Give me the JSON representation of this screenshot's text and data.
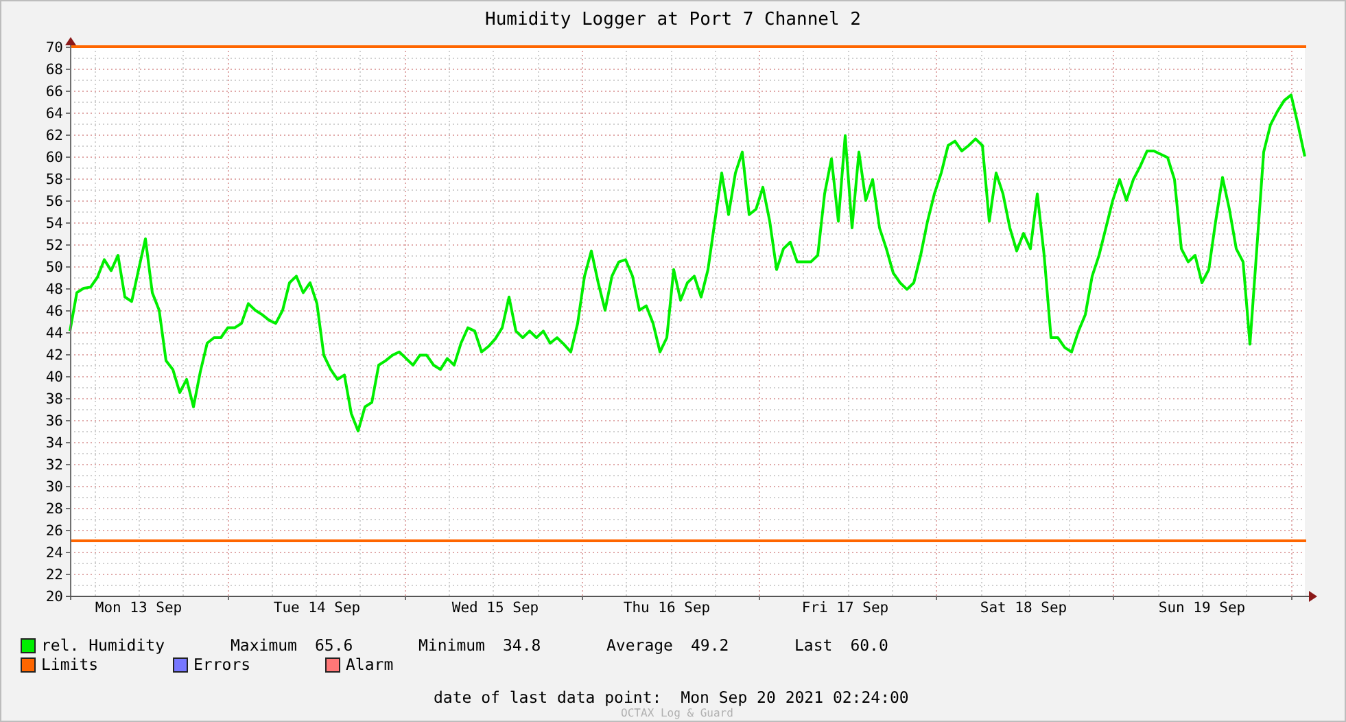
{
  "title": "Humidity Logger at Port 7 Channel 2",
  "chart": {
    "chart_data": {
      "type": "line",
      "ylim": [
        20,
        70
      ],
      "grid": true,
      "yticks": [
        20,
        22,
        24,
        26,
        28,
        30,
        32,
        34,
        36,
        38,
        40,
        42,
        44,
        46,
        48,
        50,
        52,
        54,
        56,
        58,
        60,
        62,
        64,
        66,
        68,
        70
      ],
      "categories": [
        null,
        null,
        null,
        null,
        null,
        null,
        null,
        null,
        null,
        null,
        "Mon 13 Sep",
        null,
        null,
        null,
        null,
        null,
        null,
        null,
        null,
        null,
        null,
        null,
        null,
        null,
        null,
        null,
        null,
        null,
        null,
        null,
        null,
        null,
        null,
        null,
        null,
        null,
        "Tue 14 Sep",
        null,
        null,
        null,
        null,
        null,
        null,
        null,
        null,
        null,
        null,
        null,
        null,
        null,
        null,
        null,
        null,
        null,
        null,
        null,
        null,
        null,
        null,
        null,
        null,
        null,
        "Wed 15 Sep",
        null,
        null,
        null,
        null,
        null,
        null,
        null,
        null,
        null,
        null,
        null,
        null,
        null,
        null,
        null,
        null,
        null,
        null,
        null,
        null,
        null,
        null,
        null,
        null,
        "Thu 16 Sep",
        null,
        null,
        null,
        null,
        null,
        null,
        null,
        null,
        null,
        null,
        null,
        null,
        null,
        null,
        null,
        null,
        null,
        null,
        null,
        null,
        null,
        null,
        null,
        null,
        null,
        "Fri 17 Sep",
        null,
        null,
        null,
        null,
        null,
        null,
        null,
        null,
        null,
        null,
        null,
        null,
        null,
        null,
        null,
        null,
        null,
        null,
        null,
        null,
        null,
        null,
        null,
        null,
        null,
        "Sat 18 Sep",
        null,
        null,
        null,
        null,
        null,
        null,
        null,
        null,
        null,
        null,
        null,
        null,
        null,
        null,
        null,
        null,
        null,
        null,
        null,
        null,
        null,
        null,
        null,
        null,
        null,
        "Sun 19 Sep",
        null,
        null,
        null,
        null,
        null,
        null,
        null,
        null,
        null,
        null,
        null,
        null,
        null,
        null,
        null
      ],
      "series": [
        {
          "name": "rel. Humidity",
          "color": "#00ee00",
          "values": [
            44.1,
            47.6,
            48,
            48.1,
            49,
            50.6,
            49.6,
            51,
            47.2,
            46.8,
            49.7,
            52.5,
            47.6,
            46,
            41.4,
            40.6,
            38.5,
            39.7,
            37.2,
            40.4,
            43,
            43.5,
            43.5,
            44.4,
            44.4,
            44.8,
            46.6,
            46,
            45.6,
            45.1,
            44.8,
            46,
            48.5,
            49.1,
            47.6,
            48.5,
            46.6,
            41.9,
            40.6,
            39.7,
            40.1,
            36.6,
            35,
            37.2,
            37.6,
            41,
            41.4,
            41.9,
            42.2,
            41.6,
            41,
            41.9,
            41.9,
            41,
            40.6,
            41.6,
            41,
            43,
            44.4,
            44.1,
            42.2,
            42.7,
            43.4,
            44.4,
            47.2,
            44.1,
            43.5,
            44.1,
            43.5,
            44.1,
            43,
            43.5,
            42.9,
            42.2,
            44.8,
            49.1,
            51.4,
            48.5,
            46,
            49.1,
            50.4,
            50.6,
            49.1,
            46,
            46.4,
            44.8,
            42.2,
            43.5,
            49.7,
            46.9,
            48.5,
            49.1,
            47.2,
            49.7,
            54.1,
            58.5,
            54.7,
            58.5,
            60.4,
            54.7,
            55.2,
            57.2,
            54.1,
            49.7,
            51.6,
            52.2,
            50.4,
            50.4,
            50.4,
            51,
            56.6,
            59.8,
            54.1,
            61.9,
            53.5,
            60.4,
            56,
            57.9,
            53.5,
            51.6,
            49.4,
            48.5,
            47.9,
            48.5,
            51,
            54.1,
            56.6,
            58.5,
            61,
            61.4,
            60.5,
            61,
            61.6,
            61,
            54.1,
            58.5,
            56.6,
            53.5,
            51.4,
            53,
            51.6,
            56.6,
            51,
            43.5,
            43.5,
            42.6,
            42.2,
            44.1,
            45.6,
            49.1,
            51,
            53.5,
            56,
            57.9,
            56,
            57.9,
            59.1,
            60.5,
            60.5,
            60.2,
            59.9,
            57.9,
            51.6,
            50.4,
            51,
            48.5,
            49.7,
            54.1,
            58.1,
            55.2,
            51.6,
            50.4,
            42.9,
            51.6,
            60.4,
            62.9,
            64.1,
            65.1,
            65.6,
            62.9,
            60
          ]
        }
      ],
      "ref_lines": [
        {
          "axis": "y",
          "value": 70
        },
        {
          "axis": "y",
          "value": 25
        }
      ]
    }
  },
  "legend": [
    {
      "kind": "series",
      "stats": [
        {
          "label": "Maximum",
          "value": "65.6"
        },
        {
          "label": "Minimum",
          "value": "34.8"
        },
        {
          "label": "Average",
          "value": "49.2"
        },
        {
          "label": "Last",
          "value": "60.0"
        }
      ]
    },
    {
      "label": "Limits",
      "color": "#ff6600"
    },
    {
      "label": "Errors",
      "color": "#7777ff"
    },
    {
      "label": "Alarm",
      "color": "#ff7777"
    }
  ],
  "footer": {
    "label": "date of last data point:",
    "value": "Mon Sep 20 2021 02:24:00"
  },
  "credit": "OCTAX Log & Guard"
}
